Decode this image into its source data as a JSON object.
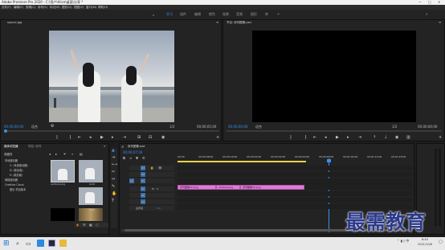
{
  "window": {
    "title": "Adobe Premiere Pro 2020 - C:\\用户\\Alice\\桌面\\分享 *",
    "controls": [
      "—",
      "□",
      "✕"
    ]
  },
  "menu": [
    "文件(F)",
    "编辑(E)",
    "剪辑(C)",
    "序列(S)",
    "标记(M)",
    "图形(G)",
    "视图(V)",
    "窗口(W)",
    "帮助(H)"
  ],
  "workspace_tabs": [
    "学习",
    "组件",
    "编辑",
    "颜色",
    "效果",
    "音频",
    "图形",
    "库"
  ],
  "workspace_active": "学习",
  "source_monitor": {
    "tab": "source.jpg",
    "timecode_in": "00;00;00;00",
    "fit_label": "适合",
    "scale": "1/2",
    "timecode_out": "00;00;05;00"
  },
  "program_monitor": {
    "tab": "节目: 序列图像.psd",
    "timecode_in": "00;00;00;00",
    "fit_label": "适合",
    "scale": "1/2",
    "timecode_out": "00;00;00;00"
  },
  "project_panel": {
    "tabs": [
      "媒体浏览器",
      "项目: 序列"
    ],
    "root_label": "收藏夹",
    "tree": [
      "本地驱动器",
      "C: (系统驱动器)",
      "D: (新加卷)",
      "E: (新加卷)",
      "网络驱动器",
      "Creative Cloud",
      "团队 项目版本"
    ],
    "thumbnails": [
      {
        "label": "vertical.png",
        "dur": ""
      },
      {
        "label": "",
        "dur": "4;20"
      },
      {
        "label": "",
        "dur": ""
      },
      {
        "label": "",
        "dur": "5;00"
      }
    ]
  },
  "timeline": {
    "tab": "序列图像.psd",
    "timecode": "00;00;07;04",
    "ruler": [
      "00;00",
      "00;00;08;00",
      "00;00;16;00",
      "00;00;24;00",
      "00;00;32;00",
      "00;00;40;00",
      "00;00;48;00",
      "00;01;04;00",
      "00;01;12;00",
      "00;01;20;00"
    ],
    "tracks_video": [
      "V3",
      "V2",
      "V1"
    ],
    "tracks_audio": [
      "A1",
      "A2",
      "A3"
    ],
    "master": "主声道",
    "master_value": "0.0",
    "clips": [
      "序列图像02.png",
      "vertical.png",
      "序列图像03.png",
      "序列图像08.png"
    ]
  },
  "watermark": "最需教育",
  "taskbar": {
    "time": "8:40",
    "date": "2021/10/8"
  }
}
